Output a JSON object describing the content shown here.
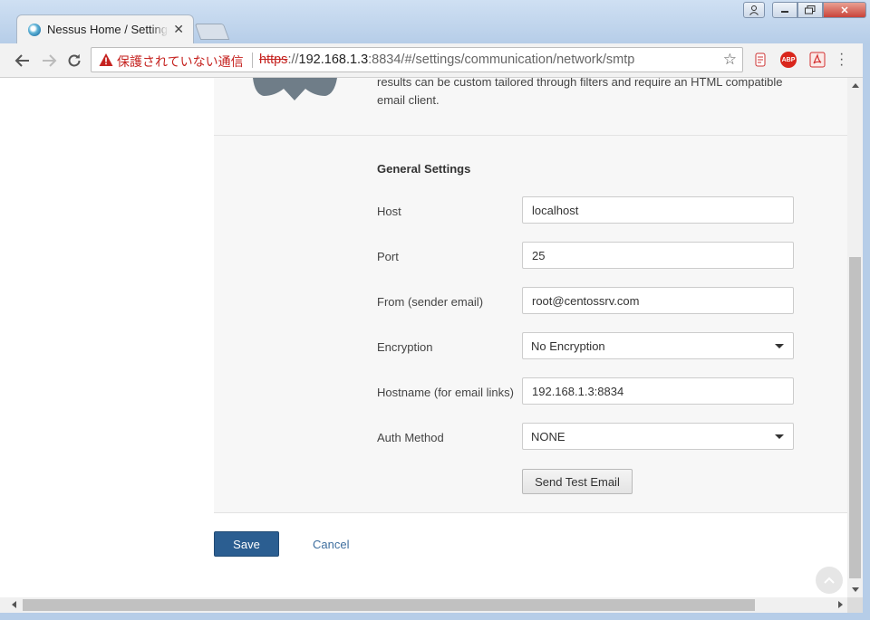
{
  "browser": {
    "tab_title": "Nessus Home / Settings",
    "security_label": "保護されていない通信",
    "url_scheme": "https",
    "url_host": "192.168.1.3",
    "url_rest": ":8834/#/settings/communication/network/smtp"
  },
  "page": {
    "description": "results can be custom tailored through filters and require an HTML compatible email client.",
    "section_title": "General Settings",
    "fields": {
      "host": {
        "label": "Host",
        "value": "localhost"
      },
      "port": {
        "label": "Port",
        "value": "25"
      },
      "from": {
        "label": "From (sender email)",
        "value": "root@centossrv.com"
      },
      "encryption": {
        "label": "Encryption",
        "value": "No Encryption"
      },
      "hostname": {
        "label": "Hostname (for email links)",
        "value": "192.168.1.3:8834"
      },
      "auth_method": {
        "label": "Auth Method",
        "value": "NONE"
      }
    },
    "send_test_label": "Send Test Email",
    "save_label": "Save",
    "cancel_label": "Cancel"
  },
  "colors": {
    "primary_button": "#2b5e91",
    "link": "#3f6f9f",
    "warning": "#c5221f"
  }
}
